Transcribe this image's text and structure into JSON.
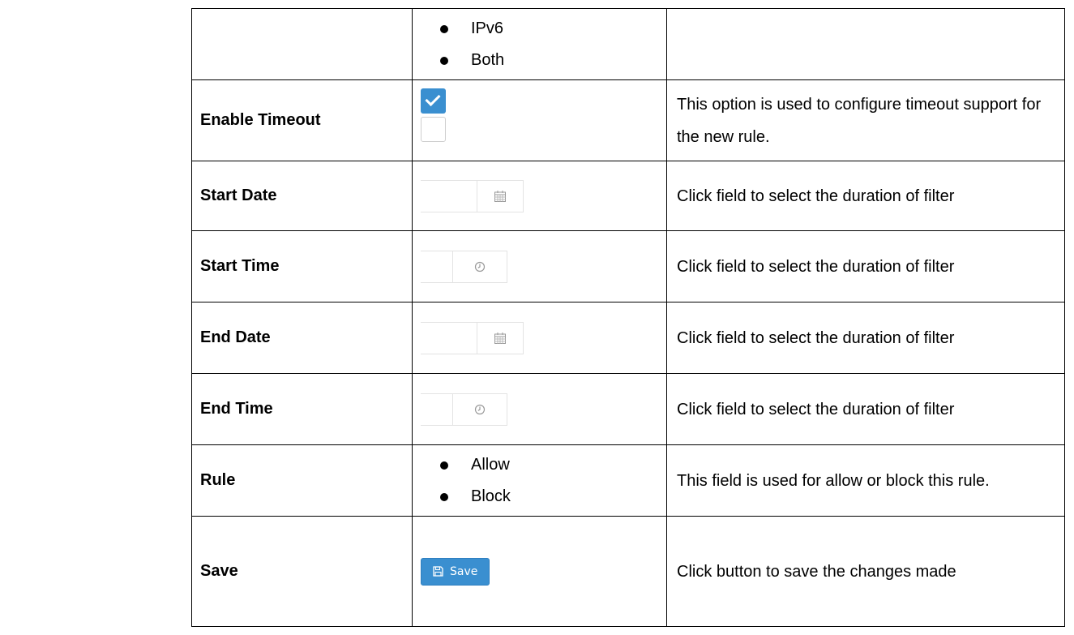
{
  "rows": {
    "ip_version": {
      "options": [
        "IPv6",
        "Both"
      ]
    },
    "enable_timeout": {
      "name": "Enable Timeout",
      "checkboxes": [
        true,
        false
      ],
      "description": "This option is used to configure timeout support for the new rule."
    },
    "start_date": {
      "name": "Start Date",
      "icon": "calendar-icon",
      "description": "Click field to select the duration of filter"
    },
    "start_time": {
      "name": "Start Time",
      "icon": "clock-icon",
      "description": "Click field to select the duration of filter"
    },
    "end_date": {
      "name": "End Date",
      "icon": "calendar-icon",
      "description": "Click field to select the duration of filter"
    },
    "end_time": {
      "name": "End Time",
      "icon": "clock-icon",
      "description": "Click field to select the duration of filter"
    },
    "rule": {
      "name": "Rule",
      "options": [
        "Allow",
        "Block"
      ],
      "description": "This field is used for allow or block this rule."
    },
    "save": {
      "name": "Save",
      "button_label": "Save",
      "button_icon": "floppy-disk-icon",
      "description": "Click button to save the changes made"
    }
  },
  "colors": {
    "accent": "#3a8fd0",
    "border": "#000000",
    "input_border": "#e3e3e3"
  }
}
